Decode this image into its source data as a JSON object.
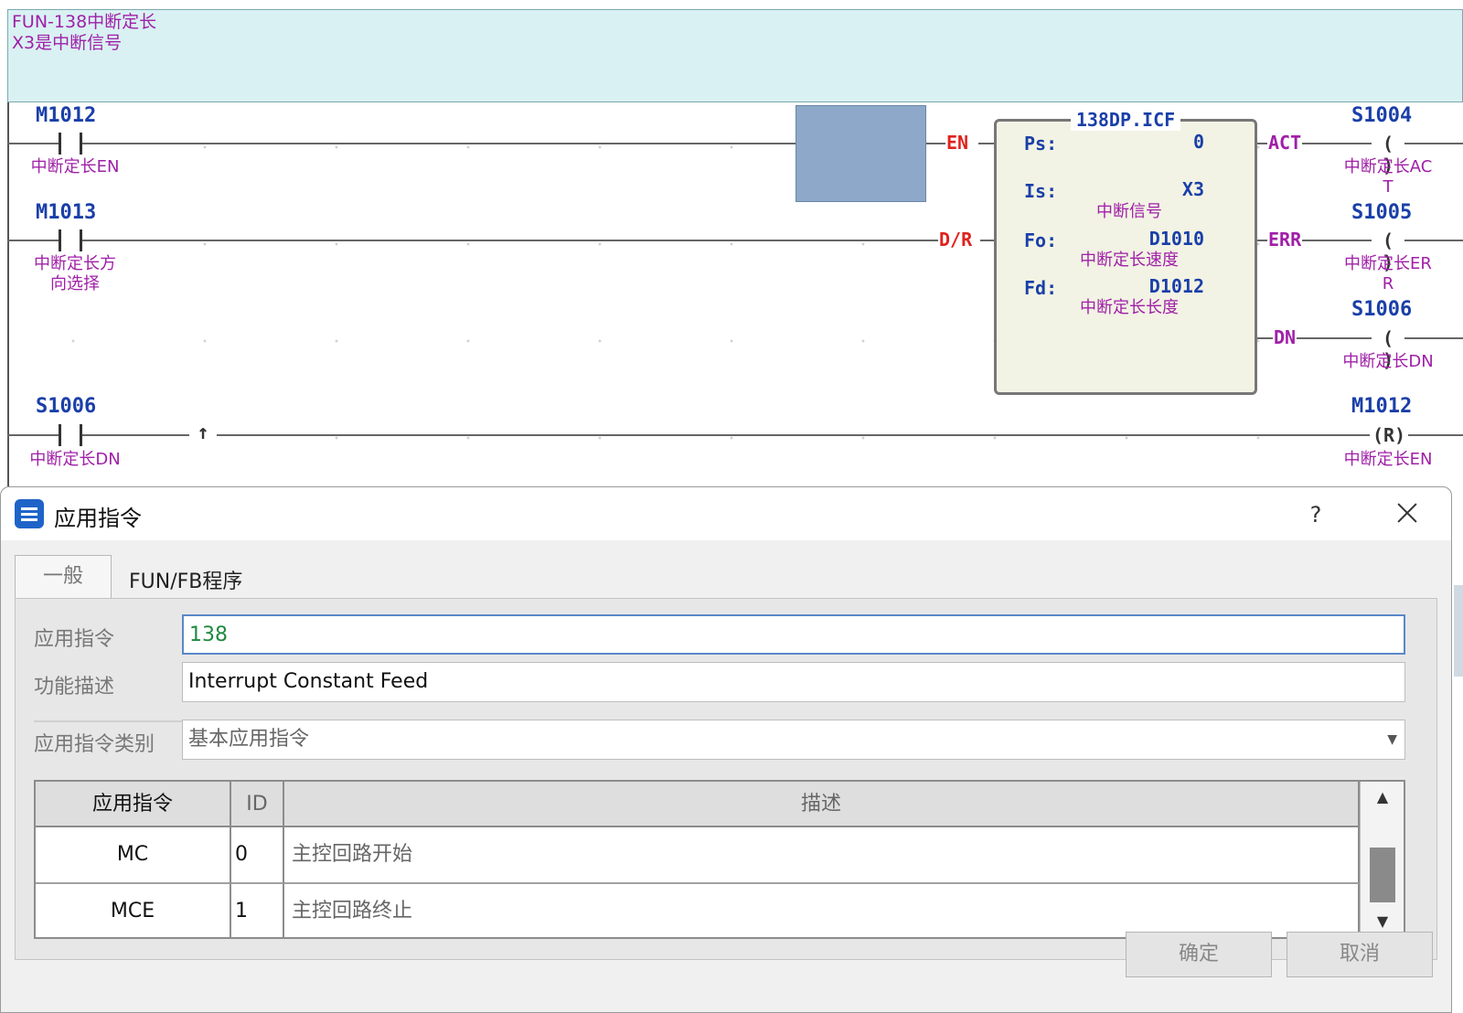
{
  "ladder": {
    "comment": [
      "FUN-138中断定长",
      "X3是中断信号"
    ],
    "rung1": {
      "contact_addr": "M1012",
      "contact_label": "中断定长EN",
      "in_pin": "EN"
    },
    "rung2": {
      "contact_addr": "M1013",
      "contact_label": [
        "中断定长方",
        "向选择"
      ],
      "in_pin": "D/R"
    },
    "rung3": {
      "contact_addr": "S1006",
      "contact_label": "中断定长DN",
      "edge_symbol": "↑",
      "coil_addr": "M1012",
      "coil_symbol": "(R)",
      "coil_label": "中断定长EN"
    },
    "block": {
      "title": "138DP.ICF",
      "params": [
        {
          "name": "Ps:",
          "value": "0",
          "comment": ""
        },
        {
          "name": "Is:",
          "value": "X3",
          "comment": "中断信号"
        },
        {
          "name": "Fo:",
          "value": "D1010",
          "comment": "中断定长速度"
        },
        {
          "name": "Fd:",
          "value": "D1012",
          "comment": "中断定长长度"
        }
      ]
    },
    "outputs": [
      {
        "pin": "ACT",
        "addr": "S1004",
        "coil": "( )",
        "label": [
          "中断定长AC",
          "T"
        ]
      },
      {
        "pin": "ERR",
        "addr": "S1005",
        "coil": "( )",
        "label": [
          "中断定长ER",
          "R"
        ]
      },
      {
        "pin": "DN",
        "addr": "S1006",
        "coil": "( )",
        "label": [
          "中断定长DN"
        ]
      }
    ]
  },
  "dialog": {
    "title": "应用指令",
    "help": "?",
    "tabs": [
      "一般",
      "FUN/FB程序"
    ],
    "fields": {
      "cmd_label": "应用指令",
      "cmd_value": "138",
      "desc_label": "功能描述",
      "desc_value": "Interrupt Constant Feed",
      "cat_label": "应用指令类别",
      "cat_value": "基本应用指令"
    },
    "table": {
      "headers": [
        "应用指令",
        "ID",
        "描述"
      ],
      "rows": [
        {
          "cmd": "MC",
          "id": "0",
          "desc": "主控回路开始"
        },
        {
          "cmd": "MCE",
          "id": "1",
          "desc": "主控回路终止"
        }
      ]
    },
    "buttons": {
      "ok": "确定",
      "cancel": "取消"
    }
  }
}
